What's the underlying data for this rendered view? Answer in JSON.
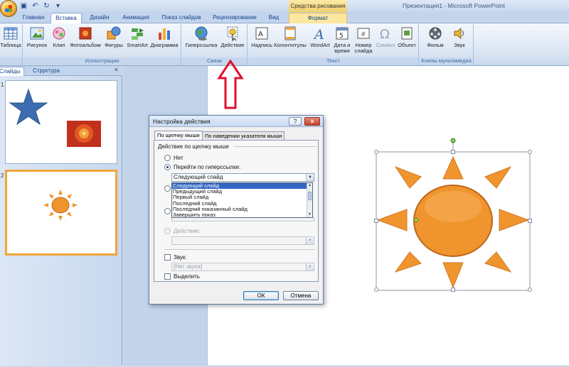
{
  "title_bar": {
    "window_title": "Презентация1 - Microsoft PowerPoint",
    "contextual_header": "Средства рисования"
  },
  "tabs": [
    {
      "label": "Главная"
    },
    {
      "label": "Вставка"
    },
    {
      "label": "Дизайн"
    },
    {
      "label": "Анимация"
    },
    {
      "label": "Показ слайдов"
    },
    {
      "label": "Рецензирование"
    },
    {
      "label": "Вид"
    },
    {
      "label": "Формат"
    }
  ],
  "active_tab": "Вставка",
  "ribbon": {
    "groups": [
      {
        "label": ""
      },
      {
        "label": "Иллюстрации"
      },
      {
        "label": "Связи"
      },
      {
        "label": "Текст"
      },
      {
        "label": "Клипы мультимедиа"
      }
    ],
    "buttons": {
      "table": "Таблица",
      "picture": "Рисунок",
      "clip": "Клип",
      "photo_album": "Фотоальбом",
      "shapes": "Фигуры",
      "smartart": "SmartArt",
      "chart": "Диаграмма",
      "hyperlink": "Гиперссылка",
      "action": "Действие",
      "textbox": "Надпись",
      "header_footer": "Колонтитулы",
      "wordart": "WordArt",
      "date_time_1": "Дата и",
      "date_time_2": "время",
      "slide_number_1": "Номер",
      "slide_number_2": "слайда",
      "symbol": "Символ",
      "object": "Объект",
      "movie": "Фильм",
      "sound": "Звук"
    }
  },
  "panel": {
    "tabs": [
      {
        "label": "Слайды"
      },
      {
        "label": "Структура"
      }
    ],
    "close": "×",
    "slide_numbers": [
      "1",
      "2"
    ]
  },
  "dialog": {
    "title": "Настройка действия",
    "help_button": "?",
    "close_button": "×",
    "tabs": [
      {
        "label": "По щелчку мыши"
      },
      {
        "label": "По наведении указателя мыши"
      }
    ],
    "group_title": "Действие по щелчку мыши",
    "radio_none": "Нет",
    "radio_hyperlink": "Перейти по гиперссылке:",
    "hyperlink_value": "Следующий слайд",
    "dropdown_options": [
      "Следующий слайд",
      "Предыдущий слайд",
      "Первый слайд",
      "Последний слайд",
      "Последний показанный слайд",
      "Завершить показ"
    ],
    "selected_option_index": 0,
    "radio_action": "Действие:",
    "sound_label": "Звук:",
    "sound_value": "[Нет звука]",
    "highlight_label": "Выделить",
    "ok": "ОК",
    "cancel": "Отмена"
  },
  "colors": {
    "star": "#3d6db0",
    "sun_fill": "#f0952e",
    "sun_stroke": "#c0661a",
    "annotation_arrow": "#e0102e",
    "selected_thumb_border": "#f0a53a"
  }
}
